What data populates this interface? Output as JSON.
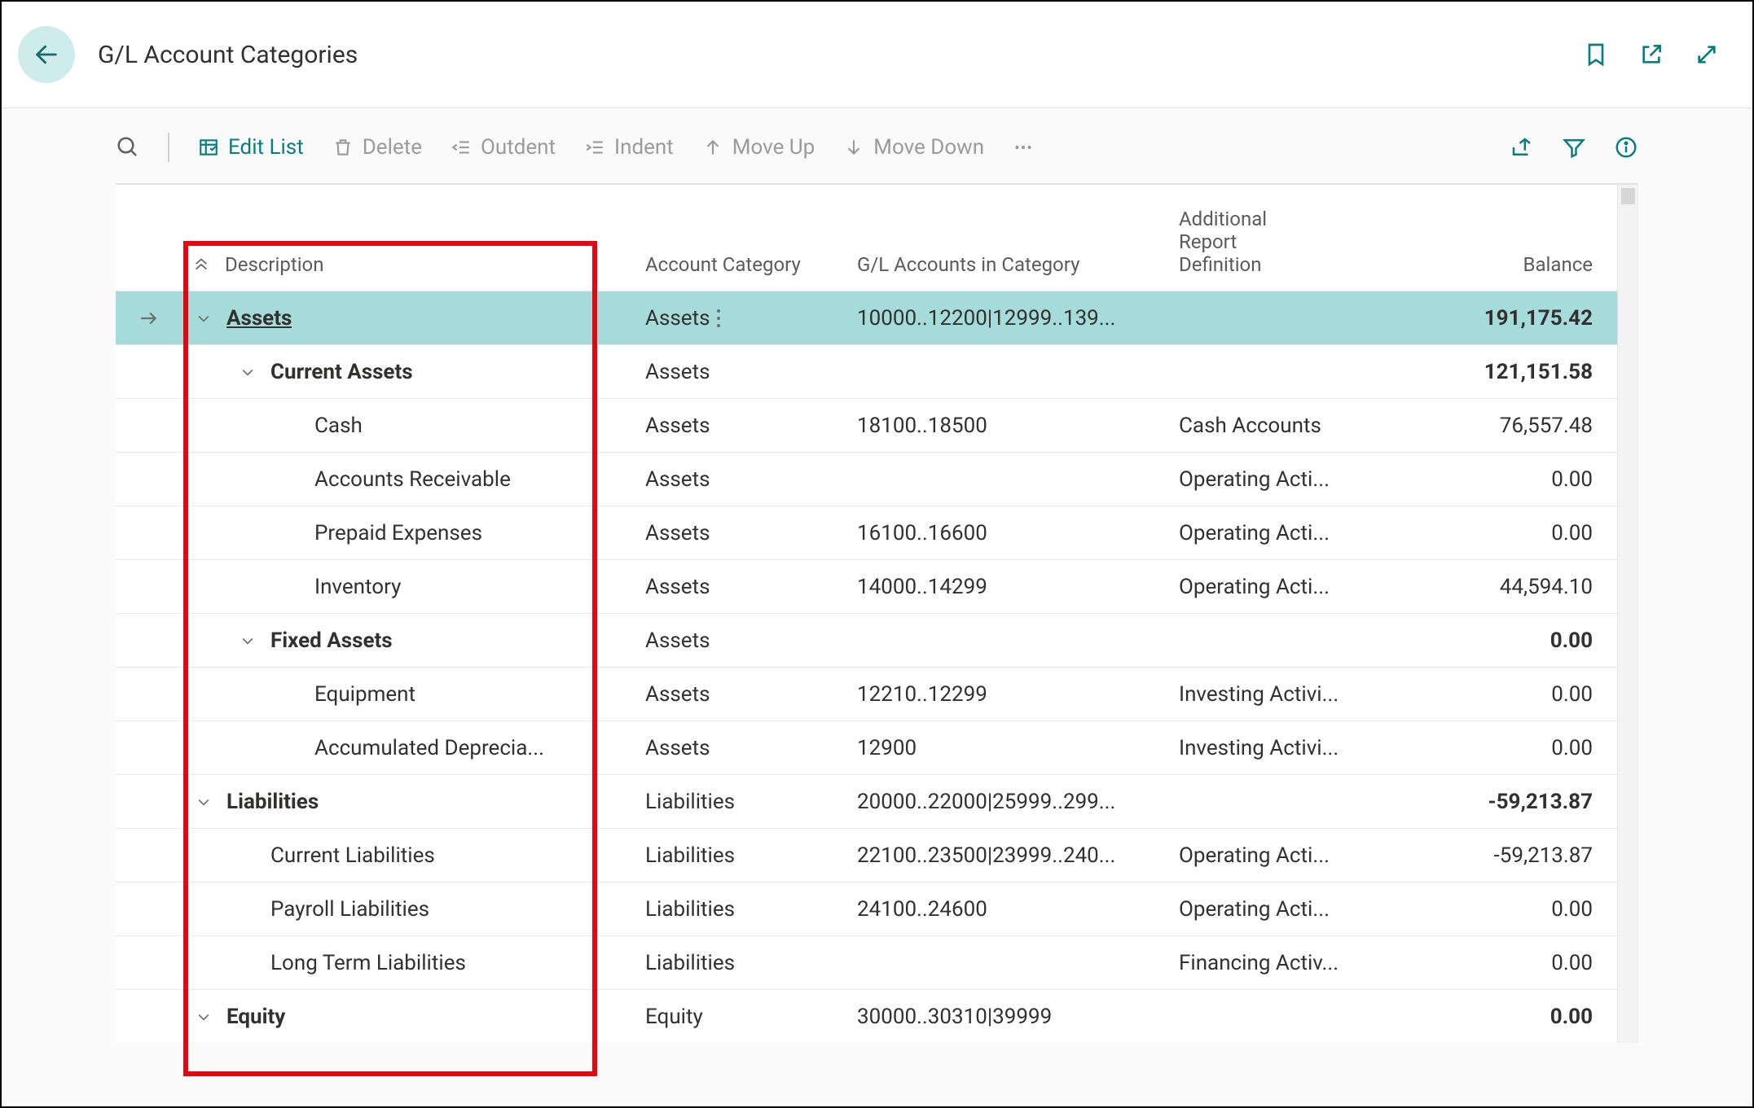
{
  "header": {
    "title": "G/L Account Categories"
  },
  "toolbar": {
    "edit_list": "Edit List",
    "delete": "Delete",
    "outdent": "Outdent",
    "indent": "Indent",
    "move_up": "Move Up",
    "move_down": "Move Down"
  },
  "columns": {
    "description": "Description",
    "category": "Account Category",
    "gl_accounts": "G/L Accounts in Category",
    "report_def_line1": "Additional",
    "report_def_line2": "Report",
    "report_def_line3": "Definition",
    "balance": "Balance"
  },
  "rows": [
    {
      "indent": 0,
      "expandable": true,
      "bold": true,
      "selected": true,
      "description": "Assets",
      "category": "Assets",
      "gl": "10000..12200|12999..139...",
      "def": "",
      "balance": "191,175.42"
    },
    {
      "indent": 1,
      "expandable": true,
      "bold": true,
      "selected": false,
      "description": "Current Assets",
      "category": "Assets",
      "gl": "",
      "def": "",
      "balance": "121,151.58"
    },
    {
      "indent": 2,
      "expandable": false,
      "bold": false,
      "selected": false,
      "description": "Cash",
      "category": "Assets",
      "gl": "18100..18500",
      "def": "Cash Accounts",
      "balance": "76,557.48"
    },
    {
      "indent": 2,
      "expandable": false,
      "bold": false,
      "selected": false,
      "description": "Accounts Receivable",
      "category": "Assets",
      "gl": "",
      "def": "Operating Acti...",
      "balance": "0.00"
    },
    {
      "indent": 2,
      "expandable": false,
      "bold": false,
      "selected": false,
      "description": "Prepaid Expenses",
      "category": "Assets",
      "gl": "16100..16600",
      "def": "Operating Acti...",
      "balance": "0.00"
    },
    {
      "indent": 2,
      "expandable": false,
      "bold": false,
      "selected": false,
      "description": "Inventory",
      "category": "Assets",
      "gl": "14000..14299",
      "def": "Operating Acti...",
      "balance": "44,594.10"
    },
    {
      "indent": 1,
      "expandable": true,
      "bold": true,
      "selected": false,
      "description": "Fixed Assets",
      "category": "Assets",
      "gl": "",
      "def": "",
      "balance": "0.00"
    },
    {
      "indent": 2,
      "expandable": false,
      "bold": false,
      "selected": false,
      "description": "Equipment",
      "category": "Assets",
      "gl": "12210..12299",
      "def": "Investing Activi...",
      "balance": "0.00"
    },
    {
      "indent": 2,
      "expandable": false,
      "bold": false,
      "selected": false,
      "description": "Accumulated Deprecia...",
      "category": "Assets",
      "gl": "12900",
      "def": "Investing Activi...",
      "balance": "0.00"
    },
    {
      "indent": 0,
      "expandable": true,
      "bold": true,
      "selected": false,
      "description": "Liabilities",
      "category": "Liabilities",
      "gl": "20000..22000|25999..299...",
      "def": "",
      "balance": "-59,213.87"
    },
    {
      "indent": 1,
      "expandable": false,
      "bold": false,
      "selected": false,
      "description": "Current Liabilities",
      "category": "Liabilities",
      "gl": "22100..23500|23999..240...",
      "def": "Operating Acti...",
      "balance": "-59,213.87"
    },
    {
      "indent": 1,
      "expandable": false,
      "bold": false,
      "selected": false,
      "description": "Payroll Liabilities",
      "category": "Liabilities",
      "gl": "24100..24600",
      "def": "Operating Acti...",
      "balance": "0.00"
    },
    {
      "indent": 1,
      "expandable": false,
      "bold": false,
      "selected": false,
      "description": "Long Term Liabilities",
      "category": "Liabilities",
      "gl": "",
      "def": "Financing Activ...",
      "balance": "0.00"
    },
    {
      "indent": 0,
      "expandable": true,
      "bold": true,
      "selected": false,
      "description": "Equity",
      "category": "Equity",
      "gl": "30000..30310|39999",
      "def": "",
      "balance": "0.00"
    }
  ]
}
